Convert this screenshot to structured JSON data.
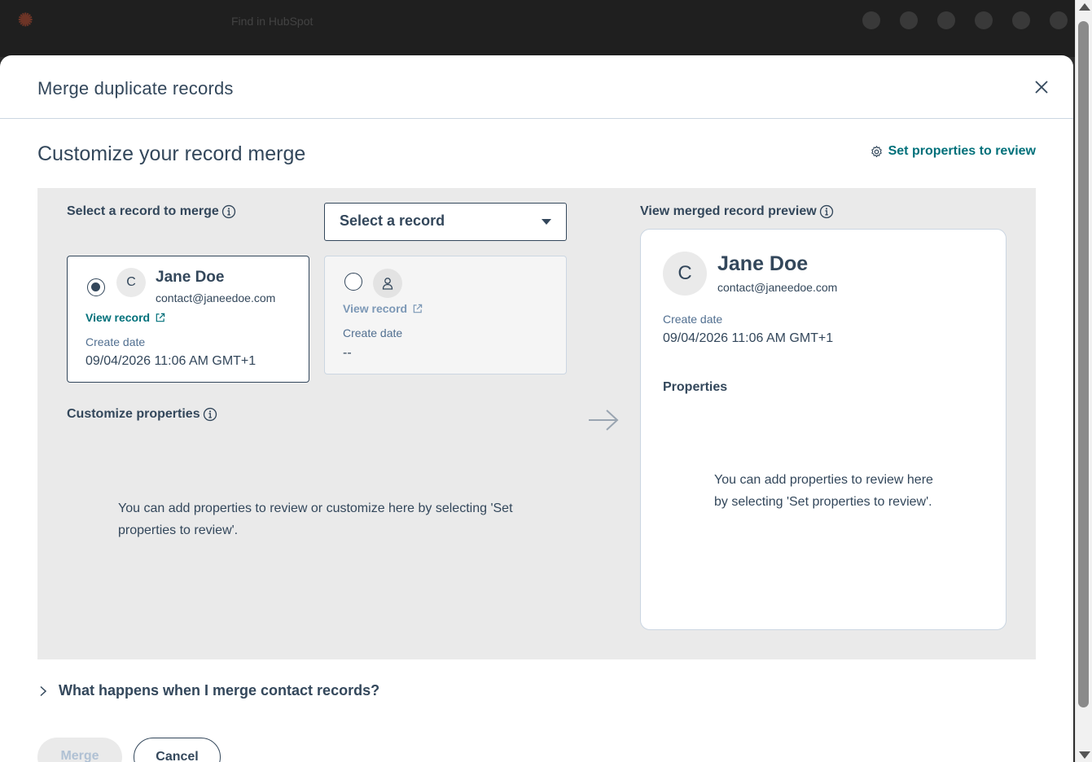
{
  "background": {
    "search_placeholder": "Find in HubSpot"
  },
  "modal": {
    "title": "Merge duplicate records",
    "section_title": "Customize your record merge",
    "set_properties_link": "Set properties to review"
  },
  "selection": {
    "label": "Select a record to merge",
    "dropdown_value": "Select a record"
  },
  "record_a": {
    "avatar_initial": "C",
    "name": "Jane Doe",
    "email": "contact@janeedoe.com",
    "view_record": "View record",
    "create_date_label": "Create date",
    "create_date": "09/04/2026 11:06 AM GMT+1",
    "selected": true
  },
  "record_b": {
    "view_record": "View record",
    "create_date_label": "Create date",
    "create_date": "--",
    "selected": false
  },
  "customize": {
    "label": "Customize properties",
    "empty_text": "You can add properties to review or customize here by selecting 'Set properties to review'."
  },
  "preview": {
    "label": "View merged record preview",
    "avatar_initial": "C",
    "name": "Jane Doe",
    "email": "contact@janeedoe.com",
    "create_date_label": "Create date",
    "create_date": "09/04/2026 11:06 AM GMT+1",
    "properties_heading": "Properties",
    "empty_text": "You can add properties to review here by selecting 'Set properties to review'."
  },
  "faq": {
    "question": "What happens when I merge contact records?"
  },
  "footer": {
    "merge_label": "Merge",
    "cancel_label": "Cancel"
  },
  "colors": {
    "accent_link": "#00707a",
    "text": "#33475b",
    "panel_bg": "#eaeaea"
  }
}
